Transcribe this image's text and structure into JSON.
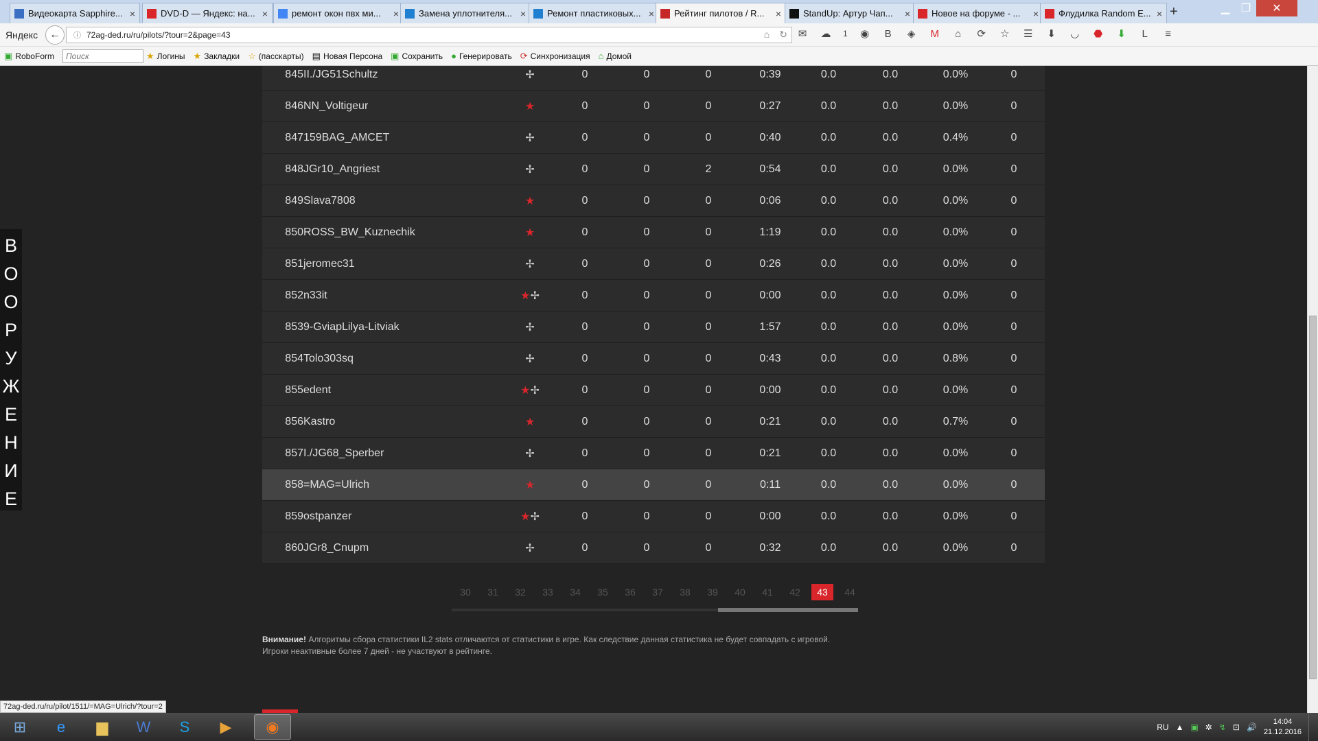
{
  "browser": {
    "brand": "Яндекс",
    "url": "72ag-ded.ru/ru/pilots/?tour=2&page=43",
    "tabs": [
      {
        "title": "Видеокарта Sapphire...",
        "icon": "sapphire-icon",
        "color": "#3a6fc4"
      },
      {
        "title": "DVD-D — Яндекс: на...",
        "icon": "yandex-icon",
        "color": "#d8262b"
      },
      {
        "title": "ремонт окон пвх ми...",
        "icon": "google-icon",
        "color": "#4285f4"
      },
      {
        "title": "Замена уплотнителя...",
        "icon": "plus-icon",
        "color": "#1f7fd1"
      },
      {
        "title": "Ремонт пластиковых...",
        "icon": "plus-icon",
        "color": "#1f7fd1"
      },
      {
        "title": "Рейтинг пилотов / R...",
        "icon": "flag-icon",
        "color": "#c62828"
      },
      {
        "title": "StandUp: Артур Чап...",
        "icon": "play-icon",
        "color": "#111111"
      },
      {
        "title": "Новое на форуме - ...",
        "icon": "star-icon",
        "color": "#d8262b"
      },
      {
        "title": "Флудилка Random E...",
        "icon": "star-icon",
        "color": "#d8262b"
      }
    ],
    "toolbar_badge": "1",
    "bookmarks": {
      "roboform": "RoboForm",
      "search_placeholder": "Поиск",
      "items": [
        "Логины",
        "Закладки",
        "(пасскарты)",
        "Новая Персона",
        "Сохранить",
        "Генерировать",
        "Синхронизация",
        "Домой"
      ]
    },
    "status_url": "72ag-ded.ru/ru/pilot/1511/=MAG=Ulrich/?tour=2"
  },
  "sidebar_tab": {
    "letters": [
      "В",
      "О",
      "О",
      "Р",
      "У",
      "Ж",
      "Е",
      "Н",
      "И",
      "Е"
    ]
  },
  "pilots": [
    {
      "rank": "845",
      "name": "II./JG51Schultz",
      "faction": "axis",
      "a": "0",
      "b": "0",
      "c": "0",
      "time": "0:39",
      "d": "0.0",
      "e": "0.0",
      "pct": "0.0%",
      "g": "0"
    },
    {
      "rank": "846",
      "name": "NN_Voltigeur",
      "faction": "allies",
      "a": "0",
      "b": "0",
      "c": "0",
      "time": "0:27",
      "d": "0.0",
      "e": "0.0",
      "pct": "0.0%",
      "g": "0"
    },
    {
      "rank": "847",
      "name": "159BAG_AMCET",
      "faction": "axis",
      "a": "0",
      "b": "0",
      "c": "0",
      "time": "0:40",
      "d": "0.0",
      "e": "0.0",
      "pct": "0.4%",
      "g": "0"
    },
    {
      "rank": "848",
      "name": "JGr10_Angriest",
      "faction": "axis",
      "a": "0",
      "b": "0",
      "c": "2",
      "time": "0:54",
      "d": "0.0",
      "e": "0.0",
      "pct": "0.0%",
      "g": "0"
    },
    {
      "rank": "849",
      "name": "Slava7808",
      "faction": "allies",
      "a": "0",
      "b": "0",
      "c": "0",
      "time": "0:06",
      "d": "0.0",
      "e": "0.0",
      "pct": "0.0%",
      "g": "0"
    },
    {
      "rank": "850",
      "name": "ROSS_BW_Kuznechik",
      "faction": "allies",
      "a": "0",
      "b": "0",
      "c": "0",
      "time": "1:19",
      "d": "0.0",
      "e": "0.0",
      "pct": "0.0%",
      "g": "0"
    },
    {
      "rank": "851",
      "name": "jeromec31",
      "faction": "axis",
      "a": "0",
      "b": "0",
      "c": "0",
      "time": "0:26",
      "d": "0.0",
      "e": "0.0",
      "pct": "0.0%",
      "g": "0"
    },
    {
      "rank": "852",
      "name": "n33it",
      "faction": "both",
      "a": "0",
      "b": "0",
      "c": "0",
      "time": "0:00",
      "d": "0.0",
      "e": "0.0",
      "pct": "0.0%",
      "g": "0"
    },
    {
      "rank": "853",
      "name": "9-GviapLilya-Litviak",
      "faction": "axis",
      "a": "0",
      "b": "0",
      "c": "0",
      "time": "1:57",
      "d": "0.0",
      "e": "0.0",
      "pct": "0.0%",
      "g": "0"
    },
    {
      "rank": "854",
      "name": "Tolo303sq",
      "faction": "axis",
      "a": "0",
      "b": "0",
      "c": "0",
      "time": "0:43",
      "d": "0.0",
      "e": "0.0",
      "pct": "0.8%",
      "g": "0"
    },
    {
      "rank": "855",
      "name": "edent",
      "faction": "both",
      "a": "0",
      "b": "0",
      "c": "0",
      "time": "0:00",
      "d": "0.0",
      "e": "0.0",
      "pct": "0.0%",
      "g": "0"
    },
    {
      "rank": "856",
      "name": "Kastro",
      "faction": "allies",
      "a": "0",
      "b": "0",
      "c": "0",
      "time": "0:21",
      "d": "0.0",
      "e": "0.0",
      "pct": "0.7%",
      "g": "0"
    },
    {
      "rank": "857",
      "name": "I./JG68_Sperber",
      "faction": "axis",
      "a": "0",
      "b": "0",
      "c": "0",
      "time": "0:21",
      "d": "0.0",
      "e": "0.0",
      "pct": "0.0%",
      "g": "0"
    },
    {
      "rank": "858",
      "name": "=MAG=Ulrich",
      "faction": "allies",
      "a": "0",
      "b": "0",
      "c": "0",
      "time": "0:11",
      "d": "0.0",
      "e": "0.0",
      "pct": "0.0%",
      "g": "0",
      "highlight": true
    },
    {
      "rank": "859",
      "name": "ostpanzer",
      "faction": "both",
      "a": "0",
      "b": "0",
      "c": "0",
      "time": "0:00",
      "d": "0.0",
      "e": "0.0",
      "pct": "0.0%",
      "g": "0"
    },
    {
      "rank": "860",
      "name": "JGr8_Cnupm",
      "faction": "axis",
      "a": "0",
      "b": "0",
      "c": "0",
      "time": "0:32",
      "d": "0.0",
      "e": "0.0",
      "pct": "0.0%",
      "g": "0"
    }
  ],
  "pagination": {
    "pages": [
      "30",
      "31",
      "32",
      "33",
      "34",
      "35",
      "36",
      "37",
      "38",
      "39",
      "40",
      "41",
      "42",
      "43",
      "44"
    ],
    "current": "43"
  },
  "notice": {
    "bold": "Внимание!",
    "text": " Алгоритмы сбора статистики IL2 stats отличаются от статистики в игре. Как следствие данная статистика не будет совпадать с игровой.",
    "line2": "Игроки неактивные более 7 дней - не участвуют в рейтинге."
  },
  "taskbar": {
    "apps": [
      "start-icon",
      "ie-icon",
      "explorer-icon",
      "word-icon",
      "skype-icon",
      "media-icon",
      "firefox-icon"
    ],
    "lang": "RU",
    "time": "14:04",
    "date": "21.12.2016"
  },
  "colors": {
    "accent": "#d8262b",
    "row_bg": "#2c2c2c",
    "page_bg": "#232323"
  }
}
